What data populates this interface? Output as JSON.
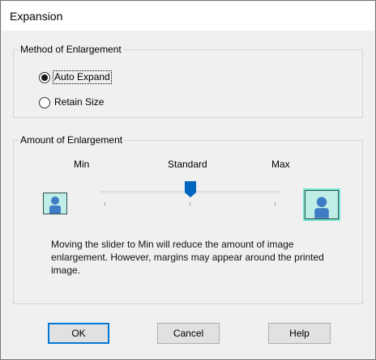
{
  "window": {
    "title": "Expansion"
  },
  "method": {
    "legend": "Method of Enlargement",
    "options": [
      {
        "label": "Auto Expand",
        "selected": true
      },
      {
        "label": "Retain Size",
        "selected": false
      }
    ]
  },
  "amount": {
    "legend": "Amount of Enlargement",
    "min_label": "Min",
    "standard_label": "Standard",
    "max_label": "Max",
    "slider_position": "Standard",
    "slider_steps": 3,
    "description": "Moving the slider to Min will reduce the amount of image enlargement. However, margins may appear around the printed image."
  },
  "buttons": {
    "ok": "OK",
    "cancel": "Cancel",
    "help": "Help"
  },
  "colors": {
    "slider_thumb": "#0067c0",
    "image_bg": "#bfeee6",
    "person": "#3f7bc4"
  }
}
